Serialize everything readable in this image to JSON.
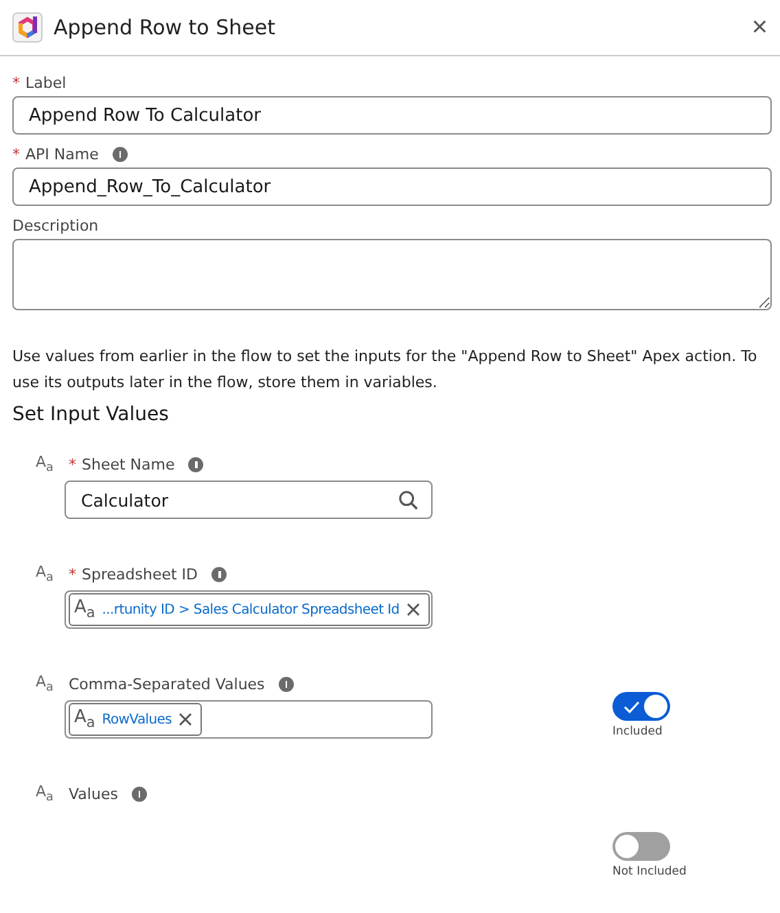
{
  "window": {
    "title": "Append Row to Sheet",
    "close": "×"
  },
  "required_mark": "*",
  "fields": [
    {
      "label": "Label",
      "required": true,
      "info": false,
      "kind": "input",
      "value": "Append Row To Calculator"
    },
    {
      "label": "API Name",
      "required": true,
      "info": true,
      "kind": "input",
      "value": "Append_Row_To_Calculator"
    },
    {
      "label": "Description",
      "required": false,
      "info": false,
      "kind": "textarea"
    }
  ],
  "intro": "Use values from earlier in the flow to set the inputs for the \"Append Row to Sheet\" Apex action. To use its outputs later in the flow, store them in variables.",
  "section_title": "Set Input Values",
  "inputs": [
    {
      "type_mark": "A$_{a}$",
      "label": "Sheet Name",
      "required": true,
      "kind": "search",
      "value": "Calculator"
    },
    {
      "type_mark": "A$_{a}$",
      "label": "Spreadsheet ID",
      "required": true,
      "kind": "pill",
      "pill_mark": "A$_{a}$",
      "value": "...rtunity ID > Sales Calculator Spreadsheet Id"
    },
    {
      "type_mark": "A$_{a}$",
      "label": "Comma-Separated Values",
      "required": false,
      "kind": "pill",
      "pill_mark": "A$_{a}$",
      "value": "RowValues",
      "toggle": {
        "on": true,
        "label": "Included"
      }
    },
    {
      "type_mark": "A$_{a}$",
      "label": "Values",
      "required": false,
      "kind": "none",
      "toggle": {
        "on": false,
        "label": "Not Included"
      }
    }
  ]
}
